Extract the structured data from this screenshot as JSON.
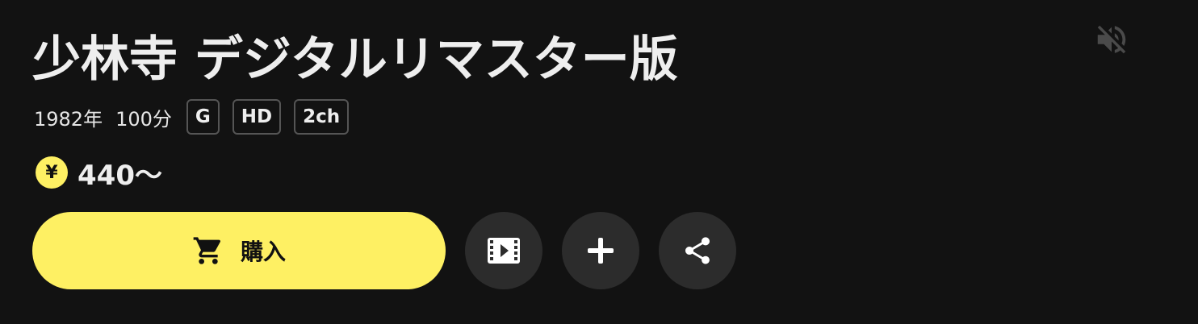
{
  "title": "少林寺 デジタルリマスター版",
  "meta": {
    "year": "1982年",
    "duration": "100分",
    "badges": [
      "G",
      "HD",
      "2ch"
    ]
  },
  "price": {
    "currency_symbol": "¥",
    "amount": "440〜"
  },
  "actions": {
    "buy_label": "購入"
  },
  "icons": {
    "mute": "speaker-muted-icon",
    "cart": "cart-icon",
    "trailer": "film-play-icon",
    "add": "plus-icon",
    "share": "share-icon"
  },
  "colors": {
    "background": "#121212",
    "accent": "#fef063",
    "circle_button": "#2c2c2c",
    "text": "#eeeeee"
  }
}
